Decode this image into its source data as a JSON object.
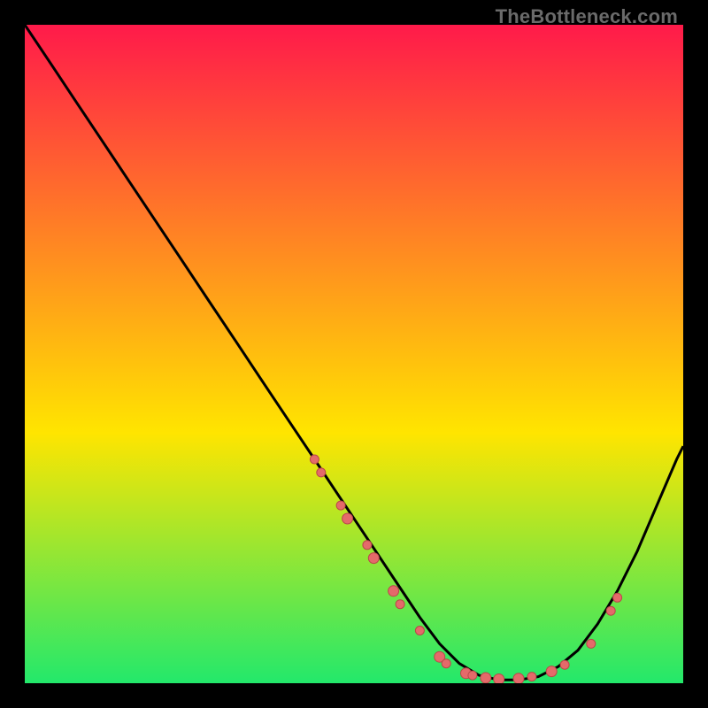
{
  "watermark": "TheBottleneck.com",
  "colors": {
    "gradient_top": "#ff1a4a",
    "gradient_mid": "#ffe500",
    "gradient_bottom": "#23e86b",
    "curve": "#000000",
    "dot_fill": "#e46a6a",
    "dot_stroke": "#b94848",
    "frame_bg": "#000000"
  },
  "chart_data": {
    "type": "line",
    "title": "",
    "xlabel": "",
    "ylabel": "",
    "xlim": [
      0,
      100
    ],
    "ylim": [
      0,
      100
    ],
    "curve": {
      "x": [
        0,
        4,
        8,
        12,
        16,
        20,
        24,
        28,
        32,
        36,
        40,
        44,
        48,
        52,
        56,
        60,
        63,
        66,
        69,
        72,
        75,
        78,
        81,
        84,
        87,
        90,
        93,
        96,
        99,
        100
      ],
      "y": [
        100,
        94,
        88,
        82,
        76,
        70,
        64,
        58,
        52,
        46,
        40,
        34,
        28,
        22,
        16,
        10,
        6,
        3,
        1.2,
        0.5,
        0.5,
        1.0,
        2.5,
        5,
        9,
        14,
        20,
        27,
        34,
        36
      ]
    },
    "dots": [
      {
        "x": 44,
        "y": 34,
        "r": 5
      },
      {
        "x": 45,
        "y": 32,
        "r": 5
      },
      {
        "x": 48,
        "y": 27,
        "r": 5
      },
      {
        "x": 49,
        "y": 25,
        "r": 6
      },
      {
        "x": 52,
        "y": 21,
        "r": 5
      },
      {
        "x": 53,
        "y": 19,
        "r": 6
      },
      {
        "x": 56,
        "y": 14,
        "r": 6
      },
      {
        "x": 57,
        "y": 12,
        "r": 5
      },
      {
        "x": 60,
        "y": 8,
        "r": 5
      },
      {
        "x": 63,
        "y": 4,
        "r": 6
      },
      {
        "x": 64,
        "y": 3,
        "r": 5
      },
      {
        "x": 67,
        "y": 1.5,
        "r": 6
      },
      {
        "x": 68,
        "y": 1.2,
        "r": 5
      },
      {
        "x": 70,
        "y": 0.8,
        "r": 6
      },
      {
        "x": 72,
        "y": 0.6,
        "r": 6
      },
      {
        "x": 75,
        "y": 0.7,
        "r": 6
      },
      {
        "x": 77,
        "y": 1.0,
        "r": 5
      },
      {
        "x": 80,
        "y": 1.8,
        "r": 6
      },
      {
        "x": 82,
        "y": 2.8,
        "r": 5
      },
      {
        "x": 86,
        "y": 6,
        "r": 5
      },
      {
        "x": 89,
        "y": 11,
        "r": 5
      },
      {
        "x": 90,
        "y": 13,
        "r": 5
      }
    ]
  }
}
